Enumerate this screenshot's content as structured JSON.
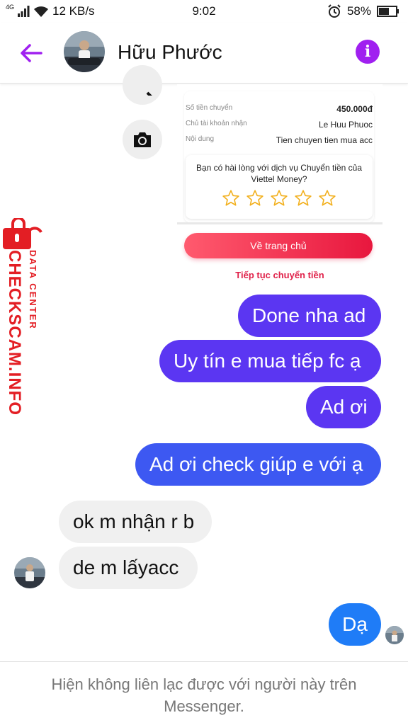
{
  "status_bar": {
    "network": "4G",
    "speed": "12 KB/s",
    "time": "9:02",
    "battery": "58%"
  },
  "header": {
    "contact_name": "Hữu Phước"
  },
  "receipt": {
    "amount_label": "Số tiền chuyển",
    "amount_value": "450.000đ",
    "holder_label": "Chủ tài khoản nhận",
    "holder_value": "Le Huu Phuoc",
    "content_label": "Nội dung",
    "content_value": "Tien chuyen tien mua acc",
    "survey_question": "Bạn có hài lòng với dịch vụ Chuyển tiền của Viettel Money?",
    "rating_stars": 5,
    "home_button": "Về trang chủ",
    "continue_link": "Tiếp tục chuyển tiền"
  },
  "watermark": {
    "brand": "CHECKSCAM.INFO",
    "subtitle": "DATA CENTER"
  },
  "messages": [
    {
      "sender": "me",
      "text": "Done nha ad"
    },
    {
      "sender": "me",
      "text": "Uy tín e mua tiếp fc ạ"
    },
    {
      "sender": "me",
      "text": "Ad ơi"
    },
    {
      "sender": "me",
      "text": "Ad ơi check giúp e với ạ"
    },
    {
      "sender": "them",
      "text": "ok m nhận r b"
    },
    {
      "sender": "them",
      "text": "de m lấyacc"
    },
    {
      "sender": "me",
      "text": "Dạ"
    }
  ],
  "footer": {
    "notice": "Hiện không liên lạc được với người này trên Messenger."
  },
  "colors": {
    "accent_purple": "#a020f0",
    "bubble_purple": "#5b36f2",
    "bubble_blue": "#1f7cf7",
    "viettel_red": "#e8173e",
    "watermark_red": "#e31e24"
  }
}
